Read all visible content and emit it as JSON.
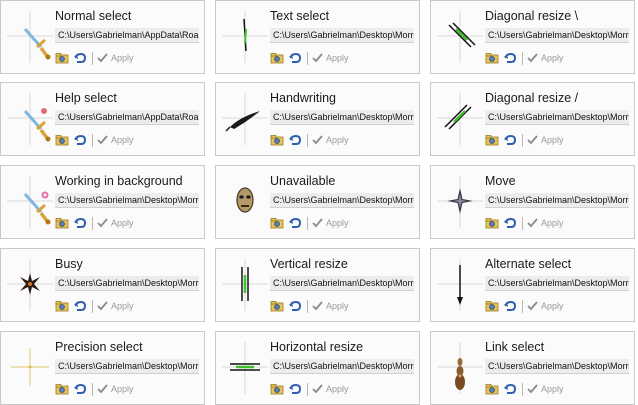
{
  "apply_label": "Apply",
  "cursors": [
    {
      "title": "Normal select",
      "path": "C:\\Users\\Gabrielman\\AppData\\Roamin",
      "icon": "sword-arrow-icon"
    },
    {
      "title": "Text select",
      "path": "C:\\Users\\Gabrielman\\Desktop\\Morrowi",
      "icon": "text-beam-icon"
    },
    {
      "title": "Diagonal resize \\",
      "path": "C:\\Users\\Gabrielman\\Desktop\\Morrowi",
      "icon": "diagonal-resize-nwse-icon"
    },
    {
      "title": "Help select",
      "path": "C:\\Users\\Gabrielman\\AppData\\Roamin",
      "icon": "sword-help-icon"
    },
    {
      "title": "Handwriting",
      "path": "C:\\Users\\Gabrielman\\Desktop\\Morrowi",
      "icon": "quill-icon"
    },
    {
      "title": "Diagonal resize /",
      "path": "C:\\Users\\Gabrielman\\Desktop\\Morrowi",
      "icon": "diagonal-resize-nesw-icon"
    },
    {
      "title": "Working in background",
      "path": "C:\\Users\\Gabrielman\\Desktop\\Morrowi",
      "icon": "sword-working-icon"
    },
    {
      "title": "Unavailable",
      "path": "C:\\Users\\Gabrielman\\Desktop\\Morrowi",
      "icon": "mask-icon"
    },
    {
      "title": "Move",
      "path": "C:\\Users\\Gabrielman\\Desktop\\Morrowi",
      "icon": "move-star-icon"
    },
    {
      "title": "Busy",
      "path": "C:\\Users\\Gabrielman\\Desktop\\Morrowi",
      "icon": "busy-star-icon"
    },
    {
      "title": "Vertical resize",
      "path": "C:\\Users\\Gabrielman\\Desktop\\Morrowi",
      "icon": "vertical-resize-icon"
    },
    {
      "title": "Alternate select",
      "path": "C:\\Users\\Gabrielman\\Desktop\\Morrowi",
      "icon": "alternate-arrow-icon"
    },
    {
      "title": "Precision select",
      "path": "C:\\Users\\Gabrielman\\Desktop\\Morrowi",
      "icon": "crosshair-icon"
    },
    {
      "title": "Horizontal resize",
      "path": "C:\\Users\\Gabrielman\\Desktop\\Morrowi",
      "icon": "horizontal-resize-icon"
    },
    {
      "title": "Link select",
      "path": "C:\\Users\\Gabrielman\\Desktop\\Morrowi",
      "icon": "hand-link-icon"
    }
  ],
  "colors": {
    "accent_green": "#3bbf2a",
    "sword_gold": "#d8a43a",
    "sword_blade": "#7fb6e0",
    "border": "#c9c9c9",
    "apply_gray": "#9a9a9a"
  }
}
